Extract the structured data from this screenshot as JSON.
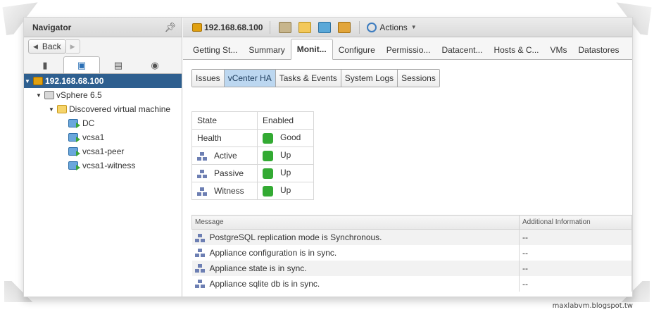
{
  "navigator": {
    "title": "Navigator",
    "back_label": "Back",
    "tree": [
      {
        "label": "192.168.68.100",
        "icon": "vcenter-icon",
        "selected": true
      },
      {
        "label": "vSphere 6.5",
        "icon": "datacenter-icon"
      },
      {
        "label": "Discovered virtual machine",
        "icon": "folder-icon"
      },
      {
        "label": "DC",
        "icon": "vm-icon"
      },
      {
        "label": "vcsa1",
        "icon": "vm-icon"
      },
      {
        "label": "vcsa1-peer",
        "icon": "vm-icon"
      },
      {
        "label": "vcsa1-witness",
        "icon": "vm-icon"
      }
    ]
  },
  "header": {
    "object_title": "192.168.68.100",
    "actions_label": "Actions"
  },
  "tabs": [
    "Getting St...",
    "Summary",
    "Monit...",
    "Configure",
    "Permissio...",
    "Datacent...",
    "Hosts & C...",
    "VMs",
    "Datastores"
  ],
  "active_tab": "Monit...",
  "subtabs": [
    "Issues",
    "vCenter HA",
    "Tasks & Events",
    "System Logs",
    "Sessions"
  ],
  "active_subtab": "vCenter HA",
  "status_table": {
    "state_label": "State",
    "state_value": "Enabled",
    "health_label": "Health",
    "health_value": "Good",
    "nodes": [
      {
        "label": "Active",
        "value": "Up"
      },
      {
        "label": "Passive",
        "value": "Up"
      },
      {
        "label": "Witness",
        "value": "Up"
      }
    ],
    "status_color": "#33aa33"
  },
  "messages": {
    "col_message": "Message",
    "col_info": "Additional Information",
    "rows": [
      {
        "message": "PostgreSQL replication mode is Synchronous.",
        "info": "--"
      },
      {
        "message": "Appliance configuration is in sync.",
        "info": "--"
      },
      {
        "message": "Appliance state is in sync.",
        "info": "--"
      },
      {
        "message": "Appliance sqlite db is in sync.",
        "info": "--"
      }
    ]
  },
  "watermark": "maxlabvm.blogspot.tw"
}
